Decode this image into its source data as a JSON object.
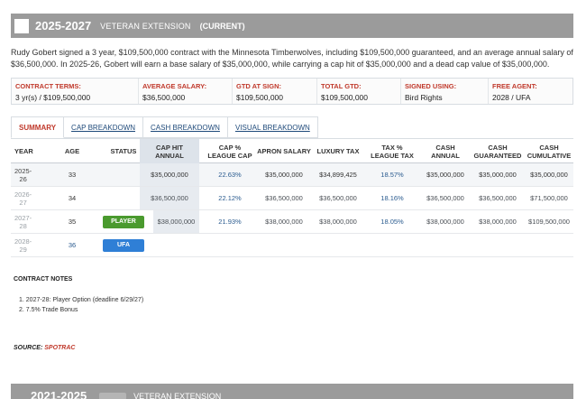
{
  "header": {
    "years": "2025-2027",
    "type": "VETERAN EXTENSION",
    "status": "(CURRENT)"
  },
  "description": "Rudy Gobert signed a 3 year, $109,500,000 contract with the Minnesota Timberwolves, including $109,500,000 guaranteed, and an average annual salary of $36,500,000. In 2025-26, Gobert will earn a base salary of $35,000,000, while carrying a cap hit of $35,000,000 and a dead cap value of $35,000,000.",
  "summary": [
    {
      "label": "CONTRACT TERMS:",
      "value": "3 yr(s) / $109,500,000"
    },
    {
      "label": "AVERAGE SALARY:",
      "value": "$36,500,000"
    },
    {
      "label": "GTD AT SIGN:",
      "value": "$109,500,000"
    },
    {
      "label": "TOTAL GTD:",
      "value": "$109,500,000"
    },
    {
      "label": "SIGNED USING:",
      "value": "Bird Rights"
    },
    {
      "label": "FREE AGENT:",
      "value": "2028 / UFA"
    }
  ],
  "tabs": [
    "SUMMARY",
    "CAP BREAKDOWN",
    "CASH BREAKDOWN",
    "VISUAL BREAKDOWN"
  ],
  "columns": [
    "YEAR",
    "AGE",
    "STATUS",
    "CAP HIT\nANNUAL",
    "CAP %\nLEAGUE CAP",
    "APRON SALARY",
    "LUXURY TAX",
    "TAX %\nLEAGUE TAX",
    "CASH\nANNUAL",
    "CASH\nGUARANTEED",
    "CASH\nCUMULATIVE"
  ],
  "rows": [
    {
      "year": "2025-\n26",
      "age": "33",
      "status": "",
      "cap_hit": "$35,000,000",
      "cap_pct": "22.63%",
      "apron": "$35,000,000",
      "lux": "$34,899,425",
      "tax_pct": "18.57%",
      "cash": "$35,000,000",
      "cash_gtd": "$35,000,000",
      "cash_cum": "$35,000,000"
    },
    {
      "year": "2026-\n27",
      "age": "34",
      "status": "",
      "cap_hit": "$36,500,000",
      "cap_pct": "22.12%",
      "apron": "$36,500,000",
      "lux": "$36,500,000",
      "tax_pct": "18.16%",
      "cash": "$36,500,000",
      "cash_gtd": "$36,500,000",
      "cash_cum": "$71,500,000"
    },
    {
      "year": "2027-\n28",
      "age": "35",
      "status": "PLAYER",
      "cap_hit": "$38,000,000",
      "cap_pct": "21.93%",
      "apron": "$38,000,000",
      "lux": "$38,000,000",
      "tax_pct": "18.05%",
      "cash": "$38,000,000",
      "cash_gtd": "$38,000,000",
      "cash_cum": "$109,500,000"
    },
    {
      "year": "2028-\n29",
      "age": "36",
      "status": "UFA",
      "cap_hit": "",
      "cap_pct": "",
      "apron": "",
      "lux": "",
      "tax_pct": "",
      "cash": "",
      "cash_gtd": "",
      "cash_cum": ""
    }
  ],
  "badge_colors": {
    "PLAYER": "#4a9a2e",
    "UFA": "#2f7fd6"
  },
  "notes_title": "CONTRACT NOTES",
  "notes": [
    "1. 2027-28: Player Option (deadline 6/29/27)",
    "2. 7.5% Trade Bonus"
  ],
  "source_label": "SOURCE:",
  "source_link": "SPOTRAC",
  "footer": {
    "years": "2021-2025",
    "type": "VETERAN EXTENSION"
  }
}
